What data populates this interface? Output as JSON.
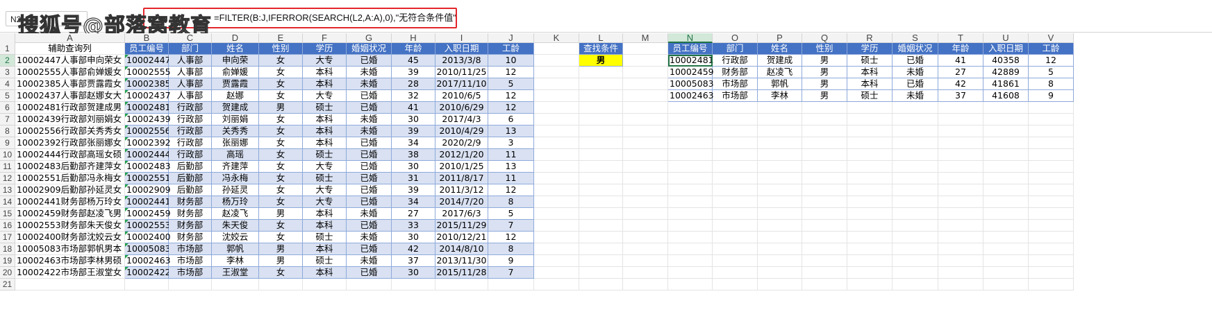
{
  "formula_bar": {
    "name_box": "N2",
    "formula": "=FILTER(B:J,IFERROR(SEARCH(L2,A:A),0),\"无符合条件值\")",
    "watermark": "搜狐号@部落窝教育"
  },
  "columns": [
    "A",
    "B",
    "C",
    "D",
    "E",
    "F",
    "G",
    "H",
    "I",
    "J",
    "K",
    "L",
    "M",
    "N",
    "O",
    "P",
    "Q",
    "R",
    "S",
    "T",
    "U",
    "V"
  ],
  "rows": [
    "1",
    "2",
    "3",
    "4",
    "5",
    "6",
    "7",
    "8",
    "9",
    "10",
    "11",
    "12",
    "13",
    "14",
    "15",
    "16",
    "17",
    "18",
    "19",
    "20",
    "21"
  ],
  "helper_header": "辅助查询列",
  "helper_values": [
    "10002447人事部申向荣女",
    "10002555人事部俞婵媛女",
    "10002385人事部贾露霞女",
    "10002437人事部赵娜女大",
    "10002481行政部贺建成男",
    "10002439行政部刘丽娟女",
    "10002556行政部关秀秀女",
    "10002392行政部张丽娜女",
    "10002444行政部高瑶女硕",
    "10002483后勤部齐建萍女",
    "10002551后勤部冯永梅女",
    "10002909后勤部孙延灵女",
    "10002441财务部杨万玲女",
    "10002459财务部赵凌飞男",
    "10002553财务部朱天俊女",
    "10002400财务部沈姣云女",
    "10005083市场部郭帆男本",
    "10002463市场部李林男硕",
    "10002422市场部王淑堂女"
  ],
  "main_table": {
    "headers": [
      "员工编号",
      "部门",
      "姓名",
      "性别",
      "学历",
      "婚姻状况",
      "年龄",
      "入职日期",
      "工龄"
    ],
    "rows": [
      [
        "10002447",
        "人事部",
        "申向荣",
        "女",
        "大专",
        "已婚",
        "45",
        "2013/3/8",
        "10"
      ],
      [
        "10002555",
        "人事部",
        "俞婵媛",
        "女",
        "本科",
        "未婚",
        "39",
        "2010/11/25",
        "12"
      ],
      [
        "10002385",
        "人事部",
        "贾露霞",
        "女",
        "本科",
        "未婚",
        "28",
        "2017/11/10",
        "5"
      ],
      [
        "10002437",
        "人事部",
        "赵娜",
        "女",
        "大专",
        "已婚",
        "32",
        "2010/6/5",
        "12"
      ],
      [
        "10002481",
        "行政部",
        "贺建成",
        "男",
        "硕士",
        "已婚",
        "41",
        "2010/6/29",
        "12"
      ],
      [
        "10002439",
        "行政部",
        "刘丽娟",
        "女",
        "本科",
        "未婚",
        "30",
        "2017/4/3",
        "6"
      ],
      [
        "10002556",
        "行政部",
        "关秀秀",
        "女",
        "本科",
        "未婚",
        "39",
        "2010/4/29",
        "13"
      ],
      [
        "10002392",
        "行政部",
        "张丽娜",
        "女",
        "本科",
        "已婚",
        "34",
        "2020/2/9",
        "3"
      ],
      [
        "10002444",
        "行政部",
        "高瑶",
        "女",
        "硕士",
        "已婚",
        "38",
        "2012/1/20",
        "11"
      ],
      [
        "10002483",
        "后勤部",
        "齐建萍",
        "女",
        "大专",
        "已婚",
        "30",
        "2010/1/25",
        "13"
      ],
      [
        "10002551",
        "后勤部",
        "冯永梅",
        "女",
        "硕士",
        "已婚",
        "31",
        "2011/8/17",
        "11"
      ],
      [
        "10002909",
        "后勤部",
        "孙延灵",
        "女",
        "大专",
        "已婚",
        "39",
        "2011/3/12",
        "12"
      ],
      [
        "10002441",
        "财务部",
        "杨万玲",
        "女",
        "大专",
        "已婚",
        "34",
        "2014/7/20",
        "8"
      ],
      [
        "10002459",
        "财务部",
        "赵凌飞",
        "男",
        "本科",
        "未婚",
        "27",
        "2017/6/3",
        "5"
      ],
      [
        "10002553",
        "财务部",
        "朱天俊",
        "女",
        "本科",
        "已婚",
        "33",
        "2015/11/29",
        "7"
      ],
      [
        "10002400",
        "财务部",
        "沈姣云",
        "女",
        "硕士",
        "未婚",
        "30",
        "2010/12/21",
        "12"
      ],
      [
        "10005083",
        "市场部",
        "郭帆",
        "男",
        "本科",
        "已婚",
        "42",
        "2014/8/10",
        "8"
      ],
      [
        "10002463",
        "市场部",
        "李林",
        "男",
        "硕士",
        "未婚",
        "37",
        "2013/11/30",
        "9"
      ],
      [
        "10002422",
        "市场部",
        "王淑堂",
        "女",
        "本科",
        "已婚",
        "30",
        "2015/11/28",
        "7"
      ]
    ]
  },
  "criteria": {
    "header": "查找条件",
    "value": "男"
  },
  "result_table": {
    "headers": [
      "员工编号",
      "部门",
      "姓名",
      "性别",
      "学历",
      "婚姻状况",
      "年龄",
      "入职日期",
      "工龄"
    ],
    "rows": [
      [
        "10002481",
        "行政部",
        "贺建成",
        "男",
        "硕士",
        "已婚",
        "41",
        "40358",
        "12"
      ],
      [
        "10002459",
        "财务部",
        "赵凌飞",
        "男",
        "本科",
        "未婚",
        "27",
        "42889",
        "5"
      ],
      [
        "10005083",
        "市场部",
        "郭帆",
        "男",
        "本科",
        "已婚",
        "42",
        "41861",
        "8"
      ],
      [
        "10002463",
        "市场部",
        "李林",
        "男",
        "硕士",
        "未婚",
        "37",
        "41608",
        "9"
      ]
    ]
  },
  "colors": {
    "header_blue": "#4472c4",
    "band_blue": "#d9e1f2",
    "highlight_yellow": "#ffff00",
    "formula_border": "#e3262b",
    "selection_green": "#217346"
  }
}
